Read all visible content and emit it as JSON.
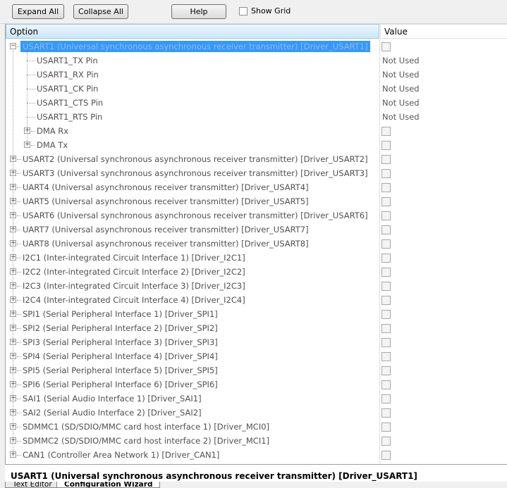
{
  "toolbar": {
    "expand_all": "Expand All",
    "collapse_all": "Collapse All",
    "help": "Help",
    "show_grid": "Show Grid"
  },
  "columns": {
    "option": "Option",
    "value": "Value"
  },
  "tree": [
    {
      "label": "USART1 (Universal synchronous asynchronous receiver transmitter) [Driver_USART1]",
      "level": 0,
      "expander": "minus",
      "selected": true,
      "value_type": "checkbox"
    },
    {
      "label": "USART1_TX Pin",
      "level": 1,
      "value_type": "text",
      "value": "Not Used"
    },
    {
      "label": "USART1_RX Pin",
      "level": 1,
      "value_type": "text",
      "value": "Not Used"
    },
    {
      "label": "USART1_CK Pin",
      "level": 1,
      "value_type": "text",
      "value": "Not Used"
    },
    {
      "label": "USART1_CTS Pin",
      "level": 1,
      "value_type": "text",
      "value": "Not Used"
    },
    {
      "label": "USART1_RTS Pin",
      "level": 1,
      "value_type": "text",
      "value": "Not Used"
    },
    {
      "label": "DMA Rx",
      "level": 1,
      "expander": "plus",
      "value_type": "checkbox"
    },
    {
      "label": "DMA Tx",
      "level": 1,
      "expander": "plus",
      "value_type": "checkbox"
    },
    {
      "label": "USART2 (Universal synchronous asynchronous receiver transmitter) [Driver_USART2]",
      "level": 0,
      "expander": "plus",
      "value_type": "checkbox"
    },
    {
      "label": "USART3 (Universal synchronous asynchronous receiver transmitter) [Driver_USART3]",
      "level": 0,
      "expander": "plus",
      "value_type": "checkbox"
    },
    {
      "label": "UART4 (Universal asynchronous receiver transmitter) [Driver_USART4]",
      "level": 0,
      "expander": "plus",
      "value_type": "checkbox"
    },
    {
      "label": "UART5 (Universal asynchronous receiver transmitter) [Driver_USART5]",
      "level": 0,
      "expander": "plus",
      "value_type": "checkbox"
    },
    {
      "label": "USART6 (Universal synchronous asynchronous receiver transmitter) [Driver_USART6]",
      "level": 0,
      "expander": "plus",
      "value_type": "checkbox"
    },
    {
      "label": "UART7 (Universal asynchronous receiver transmitter) [Driver_USART7]",
      "level": 0,
      "expander": "plus",
      "value_type": "checkbox"
    },
    {
      "label": "UART8 (Universal asynchronous receiver transmitter) [Driver_USART8]",
      "level": 0,
      "expander": "plus",
      "value_type": "checkbox"
    },
    {
      "label": "I2C1 (Inter-integrated Circuit Interface 1) [Driver_I2C1]",
      "level": 0,
      "expander": "plus",
      "value_type": "checkbox"
    },
    {
      "label": "I2C2 (Inter-integrated Circuit Interface 2) [Driver_I2C2]",
      "level": 0,
      "expander": "plus",
      "value_type": "checkbox"
    },
    {
      "label": "I2C3 (Inter-integrated Circuit Interface 3) [Driver_I2C3]",
      "level": 0,
      "expander": "plus",
      "value_type": "checkbox"
    },
    {
      "label": "I2C4 (Inter-integrated Circuit Interface 4) [Driver_I2C4]",
      "level": 0,
      "expander": "plus",
      "value_type": "checkbox"
    },
    {
      "label": "SPI1 (Serial Peripheral Interface 1) [Driver_SPI1]",
      "level": 0,
      "expander": "plus",
      "value_type": "checkbox"
    },
    {
      "label": "SPI2 (Serial Peripheral Interface 2) [Driver_SPI2]",
      "level": 0,
      "expander": "plus",
      "value_type": "checkbox"
    },
    {
      "label": "SPI3 (Serial Peripheral Interface 3) [Driver_SPI3]",
      "level": 0,
      "expander": "plus",
      "value_type": "checkbox"
    },
    {
      "label": "SPI4 (Serial Peripheral Interface 4) [Driver_SPI4]",
      "level": 0,
      "expander": "plus",
      "value_type": "checkbox"
    },
    {
      "label": "SPI5 (Serial Peripheral Interface 5) [Driver_SPI5]",
      "level": 0,
      "expander": "plus",
      "value_type": "checkbox"
    },
    {
      "label": "SPI6 (Serial Peripheral Interface 6) [Driver_SPI6]",
      "level": 0,
      "expander": "plus",
      "value_type": "checkbox"
    },
    {
      "label": "SAI1 (Serial Audio Interface 1) [Driver_SAI1]",
      "level": 0,
      "expander": "plus",
      "value_type": "checkbox"
    },
    {
      "label": "SAI2 (Serial Audio Interface 2) [Driver_SAI2]",
      "level": 0,
      "expander": "plus",
      "value_type": "checkbox"
    },
    {
      "label": "SDMMC1 (SD/SDIO/MMC card host interface 1) [Driver_MCI0]",
      "level": 0,
      "expander": "plus",
      "value_type": "checkbox"
    },
    {
      "label": "SDMMC2 (SD/SDIO/MMC card host interface 2) [Driver_MCI1]",
      "level": 0,
      "expander": "plus",
      "value_type": "checkbox"
    },
    {
      "label": "CAN1 (Controller Area Network 1) [Driver_CAN1]",
      "level": 0,
      "expander": "plus",
      "value_type": "checkbox"
    }
  ],
  "status": "USART1 (Universal synchronous asynchronous receiver transmitter) [Driver_USART1]",
  "tabs": [
    {
      "label": "Text Editor",
      "active": false
    },
    {
      "label": "Configuration Wizard",
      "active": true
    }
  ],
  "colors": {
    "selection": "#3399ff",
    "header": "#cbe6f7"
  }
}
